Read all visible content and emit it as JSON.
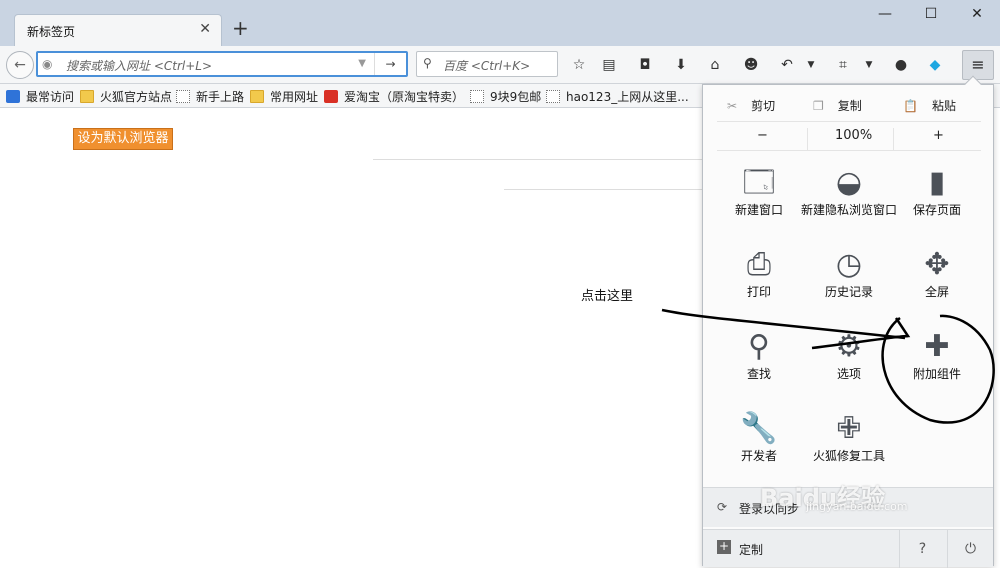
{
  "tab": {
    "title": "新标签页",
    "close": "✕"
  },
  "new_tab": "+",
  "window_controls": {
    "minimize": "—",
    "maximize": "☐",
    "close": "✕"
  },
  "nav": {
    "url_placeholder": "搜索或输入网址 <Ctrl+L>",
    "search_placeholder": "百度 <Ctrl+K>"
  },
  "bookmarks": [
    {
      "label": "最常访问",
      "icon": "blue"
    },
    {
      "label": "火狐官方站点",
      "icon": "folder"
    },
    {
      "label": "新手上路",
      "icon": "dotted"
    },
    {
      "label": "常用网址",
      "icon": "folder"
    },
    {
      "label": "爱淘宝（原淘宝特卖）",
      "icon": "red"
    },
    {
      "label": "9块9包邮",
      "icon": "dotted"
    },
    {
      "label": "hao123_上网从这里...",
      "icon": "dotted"
    }
  ],
  "content": {
    "default_browser_button": "设为默认浏览器",
    "annotation": "点击这里"
  },
  "panel": {
    "edit": {
      "cut": "剪切",
      "copy": "复制",
      "paste": "粘贴"
    },
    "zoom": {
      "minus": "−",
      "level": "100%",
      "plus": "+"
    },
    "items": [
      {
        "label": "新建窗口",
        "icon": "window-icon"
      },
      {
        "label": "新建隐私浏览窗口",
        "icon": "mask-icon"
      },
      {
        "label": "保存页面",
        "icon": "page-icon"
      },
      {
        "label": "打印",
        "icon": "printer-icon"
      },
      {
        "label": "历史记录",
        "icon": "clock-icon"
      },
      {
        "label": "全屏",
        "icon": "fullscreen-icon"
      },
      {
        "label": "查找",
        "icon": "magnifier-icon"
      },
      {
        "label": "选项",
        "icon": "gear-icon"
      },
      {
        "label": "附加组件",
        "icon": "puzzle-icon"
      },
      {
        "label": "开发者",
        "icon": "wrench-icon"
      },
      {
        "label": "火狐修复工具",
        "icon": "medkit-icon"
      }
    ],
    "sync": "登录以同步",
    "customize": "定制",
    "help": "?",
    "quit": "⏻"
  },
  "watermark": {
    "brand": "Baidu经验",
    "url": "jingyan.baidu.com"
  }
}
